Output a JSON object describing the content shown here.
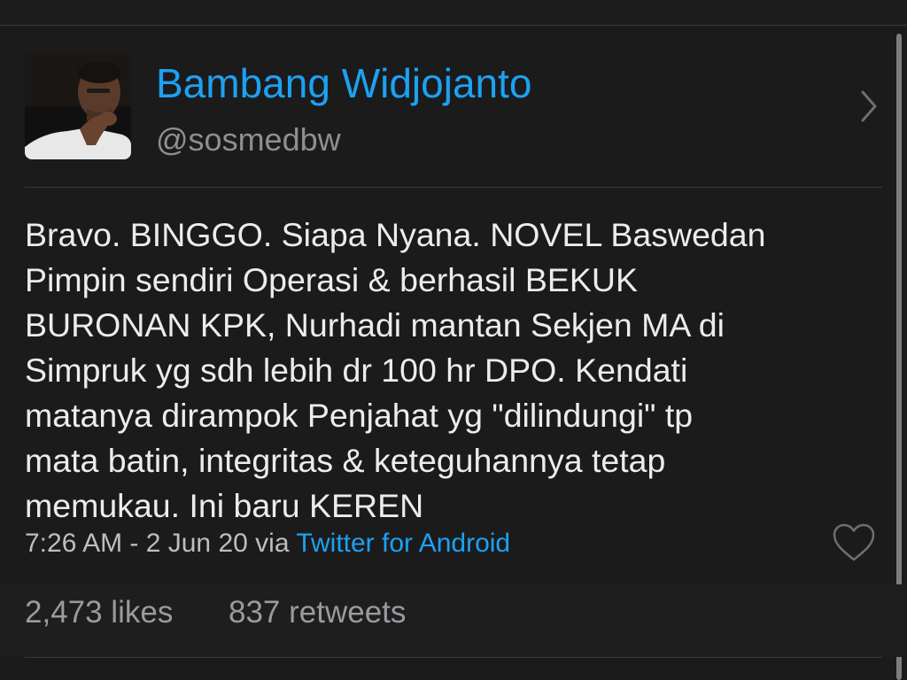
{
  "tweet": {
    "author": {
      "display_name": "Bambang Widjojanto",
      "handle": "@sosmedbw"
    },
    "text": "Bravo. BINGGO. Siapa Nyana. NOVEL Baswedan\nPimpin sendiri Operasi & berhasil BEKUK\nBURONAN KPK, Nurhadi mantan Sekjen MA di\nSimpruk yg sdh lebih dr 100 hr DPO. Kendati\nmatanya dirampok Penjahat yg \"dilindungi\" tp\nmata batin, integritas & keteguhannya tetap\nmemukau. Ini baru KEREN",
    "meta": {
      "timestamp": "7:26 AM - 2 Jun 20",
      "via": "via",
      "source": "Twitter for Android"
    },
    "stats": {
      "likes": "2,473 likes",
      "retweets": "837 retweets"
    }
  },
  "icons": {
    "chevron": "chevron-right-icon",
    "like": "heart-icon"
  },
  "colors": {
    "background": "#1c1c1d",
    "link_blue": "#1da1f2",
    "text_primary": "#ececec",
    "text_secondary": "#8e8e93"
  }
}
